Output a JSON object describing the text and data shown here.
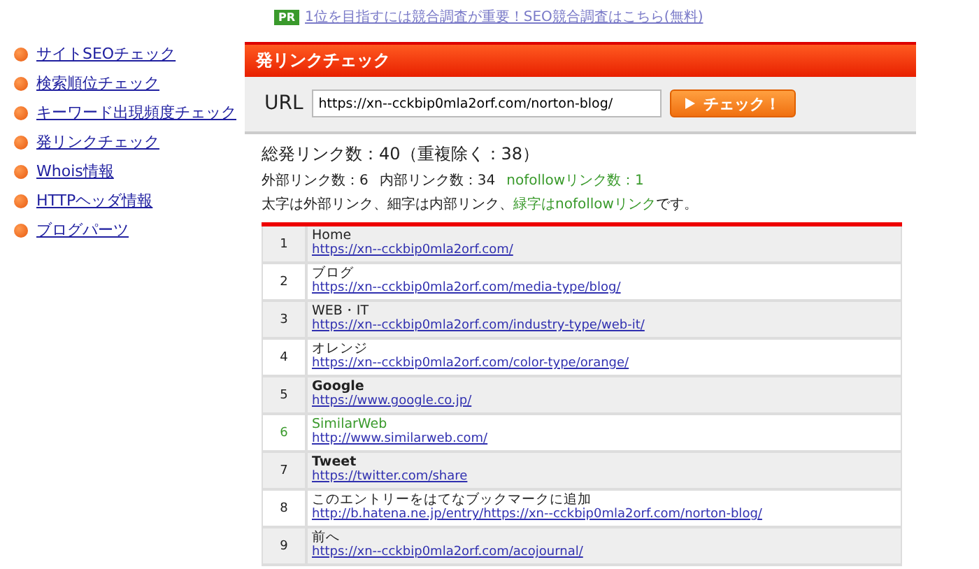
{
  "pr_banner": {
    "badge": "PR",
    "link": "1位を目指すには競合調査が重要！SEO競合調査はこちら(無料)"
  },
  "sidebar": {
    "items": [
      {
        "label": "サイトSEOチェック"
      },
      {
        "label": "検索順位チェック"
      },
      {
        "label": "キーワード出現頻度チェック"
      },
      {
        "label": "発リンクチェック"
      },
      {
        "label": "Whois情報"
      },
      {
        "label": "HTTPヘッダ情報"
      },
      {
        "label": "ブログパーツ"
      }
    ]
  },
  "panel": {
    "title": "発リンクチェック",
    "url_label": "URL",
    "url_value": "https://xn--cckbip0mla2orf.com/norton-blog/",
    "button": "チェック！"
  },
  "summary": {
    "total": "総発リンク数：40（重複除く：38）",
    "external": "外部リンク数：6",
    "internal": "内部リンク数：34",
    "nofollow": "nofollowリンク数：1",
    "legend_a": "太字は外部リンク、細字は内部リンク、",
    "legend_b": "緑字はnofollowリンク",
    "legend_c": "です。"
  },
  "table": {
    "rows": [
      {
        "no": "1",
        "title": "Home",
        "url": "https://xn--cckbip0mla2orf.com/",
        "kind": "internal"
      },
      {
        "no": "2",
        "title": "ブログ",
        "url": "https://xn--cckbip0mla2orf.com/media-type/blog/",
        "kind": "internal"
      },
      {
        "no": "3",
        "title": "WEB・IT",
        "url": "https://xn--cckbip0mla2orf.com/industry-type/web-it/",
        "kind": "internal"
      },
      {
        "no": "4",
        "title": "オレンジ",
        "url": "https://xn--cckbip0mla2orf.com/color-type/orange/",
        "kind": "internal"
      },
      {
        "no": "5",
        "title": "Google",
        "url": "https://www.google.co.jp/",
        "kind": "external"
      },
      {
        "no": "6",
        "title": "SimilarWeb",
        "url": "http://www.similarweb.com/",
        "kind": "nofollow"
      },
      {
        "no": "7",
        "title": "Tweet",
        "url": "https://twitter.com/share",
        "kind": "external"
      },
      {
        "no": "8",
        "title": "このエントリーをはてなブックマークに追加",
        "url": "http://b.hatena.ne.jp/entry/https://xn--cckbip0mla2orf.com/norton-blog/",
        "kind": "internal"
      },
      {
        "no": "9",
        "title": "前へ",
        "url": "https://xn--cckbip0mla2orf.com/acojournal/",
        "kind": "internal"
      }
    ]
  }
}
